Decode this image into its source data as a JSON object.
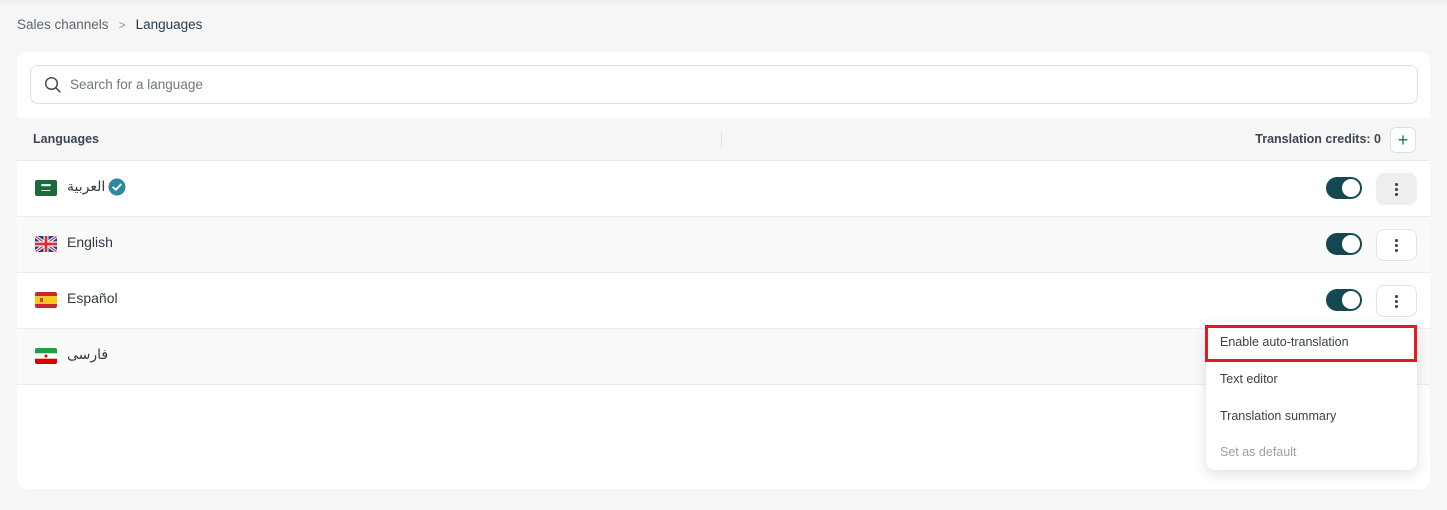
{
  "breadcrumb": {
    "parent": "Sales channels",
    "separator": ">",
    "current": "Languages"
  },
  "search": {
    "placeholder": "Search for a language",
    "value": ""
  },
  "table": {
    "header_languages": "Languages",
    "header_credits": "Translation credits: 0",
    "add_label": "+"
  },
  "languages": [
    {
      "name": "العربية",
      "flag": "saudi-arabia-flag",
      "verified": true,
      "enabled": true
    },
    {
      "name": "English",
      "flag": "uk-flag",
      "verified": false,
      "enabled": true
    },
    {
      "name": "Español",
      "flag": "spain-flag",
      "verified": false,
      "enabled": true
    },
    {
      "name": "فارسی",
      "flag": "iran-flag",
      "verified": false
    }
  ],
  "menu": {
    "items": [
      "Enable auto-translation",
      "Text editor",
      "Translation summary",
      "Set as default"
    ],
    "disabled_item": "Set as default",
    "highlighted_item": "Enable auto-translation"
  },
  "colors": {
    "toggle_on": "#144851",
    "highlight": "#e01b22",
    "verified_badge": "#2d8a9e"
  }
}
